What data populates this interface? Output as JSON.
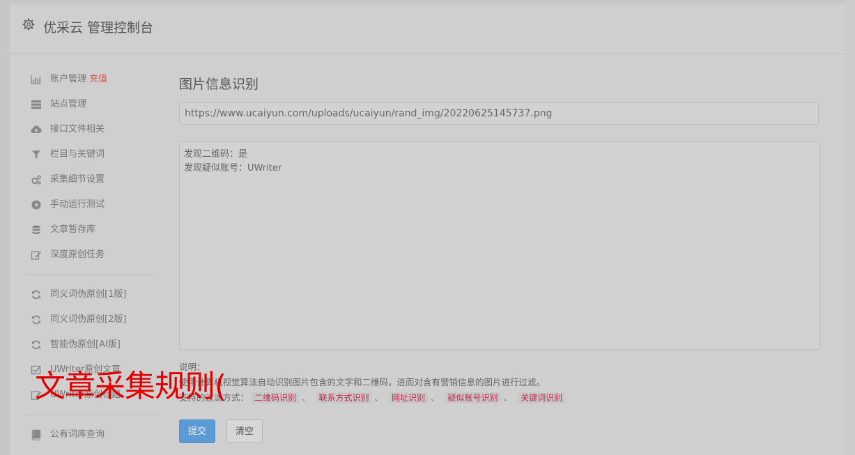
{
  "header": {
    "title": "优采云 管理控制台",
    "icon": "gear-icon"
  },
  "sidebar": {
    "group1": [
      {
        "label": "账户管理",
        "badge": "充值",
        "icon": "bar-chart-icon"
      },
      {
        "label": "站点管理",
        "icon": "server-icon"
      },
      {
        "label": "接口文件相关",
        "icon": "cloud-upload-icon"
      },
      {
        "label": "栏目与关键词",
        "icon": "filter-icon"
      },
      {
        "label": "采集细节设置",
        "icon": "cogs-icon"
      },
      {
        "label": "手动运行测试",
        "icon": "play-circle-icon"
      },
      {
        "label": "文章暂存库",
        "icon": "database-icon"
      },
      {
        "label": "深度原创任务",
        "icon": "edit-icon"
      }
    ],
    "group2": [
      {
        "label": "同义词伪原创[1版]",
        "icon": "refresh-icon"
      },
      {
        "label": "同义词伪原创[2版]",
        "icon": "refresh-icon"
      },
      {
        "label": "智能伪原创[AI版]",
        "icon": "refresh-icon"
      },
      {
        "label": "UWriter原创文章",
        "icon": "checkbox-icon"
      },
      {
        "label": "UWriter原创标题",
        "icon": "edit-icon"
      }
    ],
    "group3": [
      {
        "label": "公有词库查询",
        "icon": "book-icon"
      }
    ]
  },
  "main": {
    "title": "图片信息识别",
    "url_value": "https://www.ucaiyun.com/uploads/ucaiyun/rand_img/20220625145737.png",
    "result_lines": [
      "发现二维码：是",
      "发现疑似账号：UWriter"
    ],
    "notes_label": "说明：",
    "notes_desc": "使用计算机视觉算法自动识别图片包含的文字和二维码，进而对含有营销信息的图片进行过滤。",
    "filter_label": "支持的过滤方式：",
    "filters": [
      "二维码识别",
      "联系方式识别",
      "网址识别",
      "疑似账号识别",
      "关键词识别"
    ],
    "submit_label": "提交",
    "clear_label": "清空"
  },
  "overlay_text": "文章采集规则(",
  "colors": {
    "accent": "#5b9bd5",
    "danger": "#d9534f",
    "tag_text": "#c7254e",
    "overlay": "#e00000"
  }
}
